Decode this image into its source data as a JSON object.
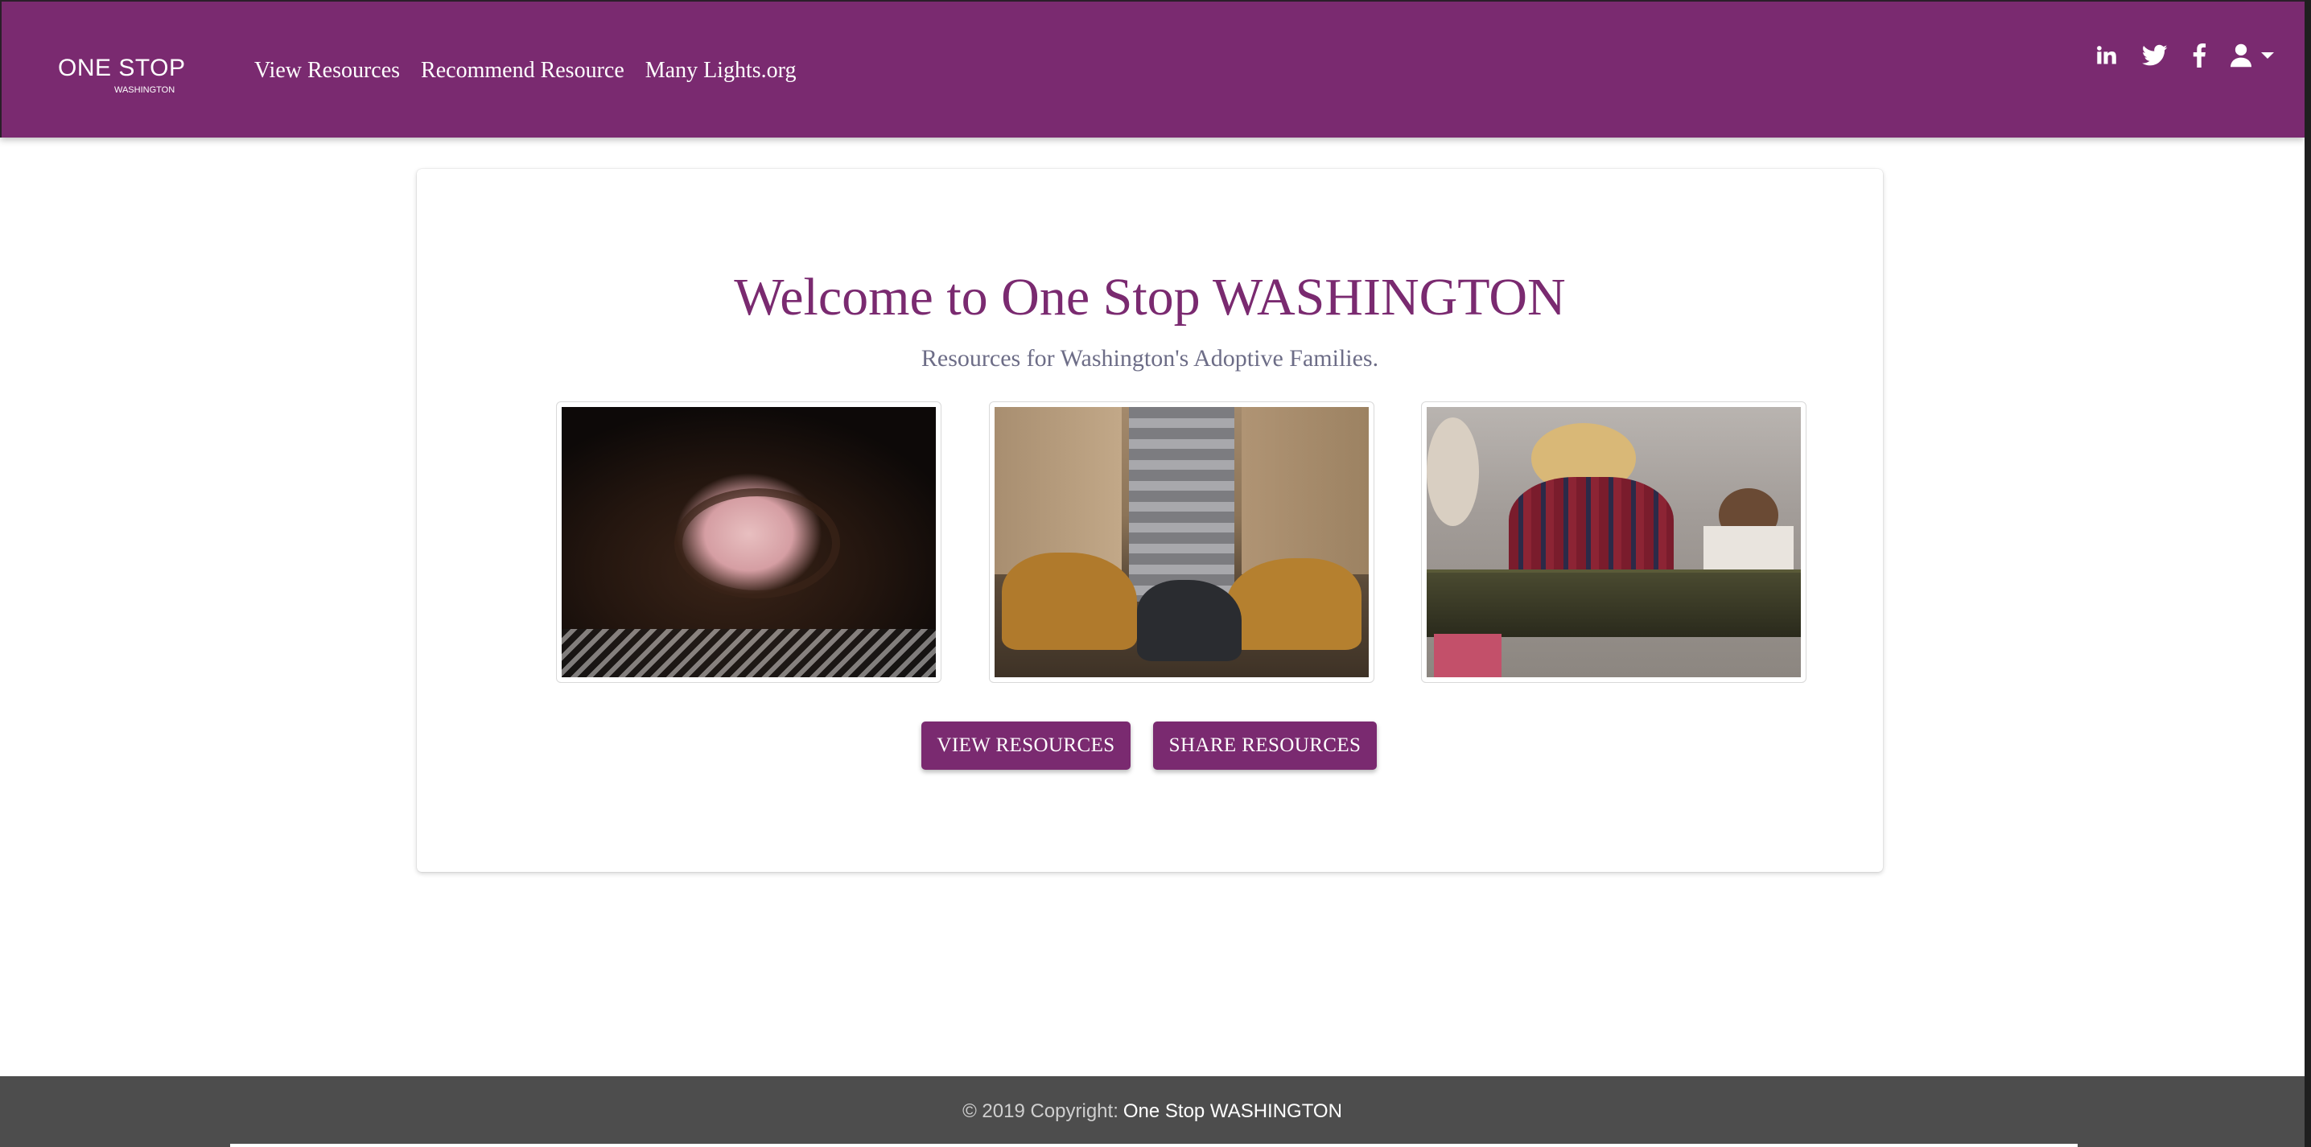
{
  "brand": {
    "name": "ONE STOP",
    "sub": "WASHINGTON"
  },
  "nav": {
    "links": [
      "View Resources",
      "Recommend Resource",
      "Many Lights.org"
    ]
  },
  "social": {
    "icons": [
      "linkedin-icon",
      "twitter-icon",
      "facebook-icon",
      "user-icon",
      "caret-down-icon"
    ]
  },
  "hero": {
    "title": "Welcome to One Stop WASHINGTON",
    "subtitle": "Resources for Washington's Adoptive Families."
  },
  "buttons": {
    "view": "VIEW RESOURCES",
    "share": "SHARE RESOURCES"
  },
  "footer": {
    "copyright": "© 2019 Copyright:",
    "site": "One Stop WASHINGTON"
  },
  "colors": {
    "brand": "#7a2a70",
    "footer": "#4d4d4d",
    "subtitle": "#6d6d87"
  }
}
